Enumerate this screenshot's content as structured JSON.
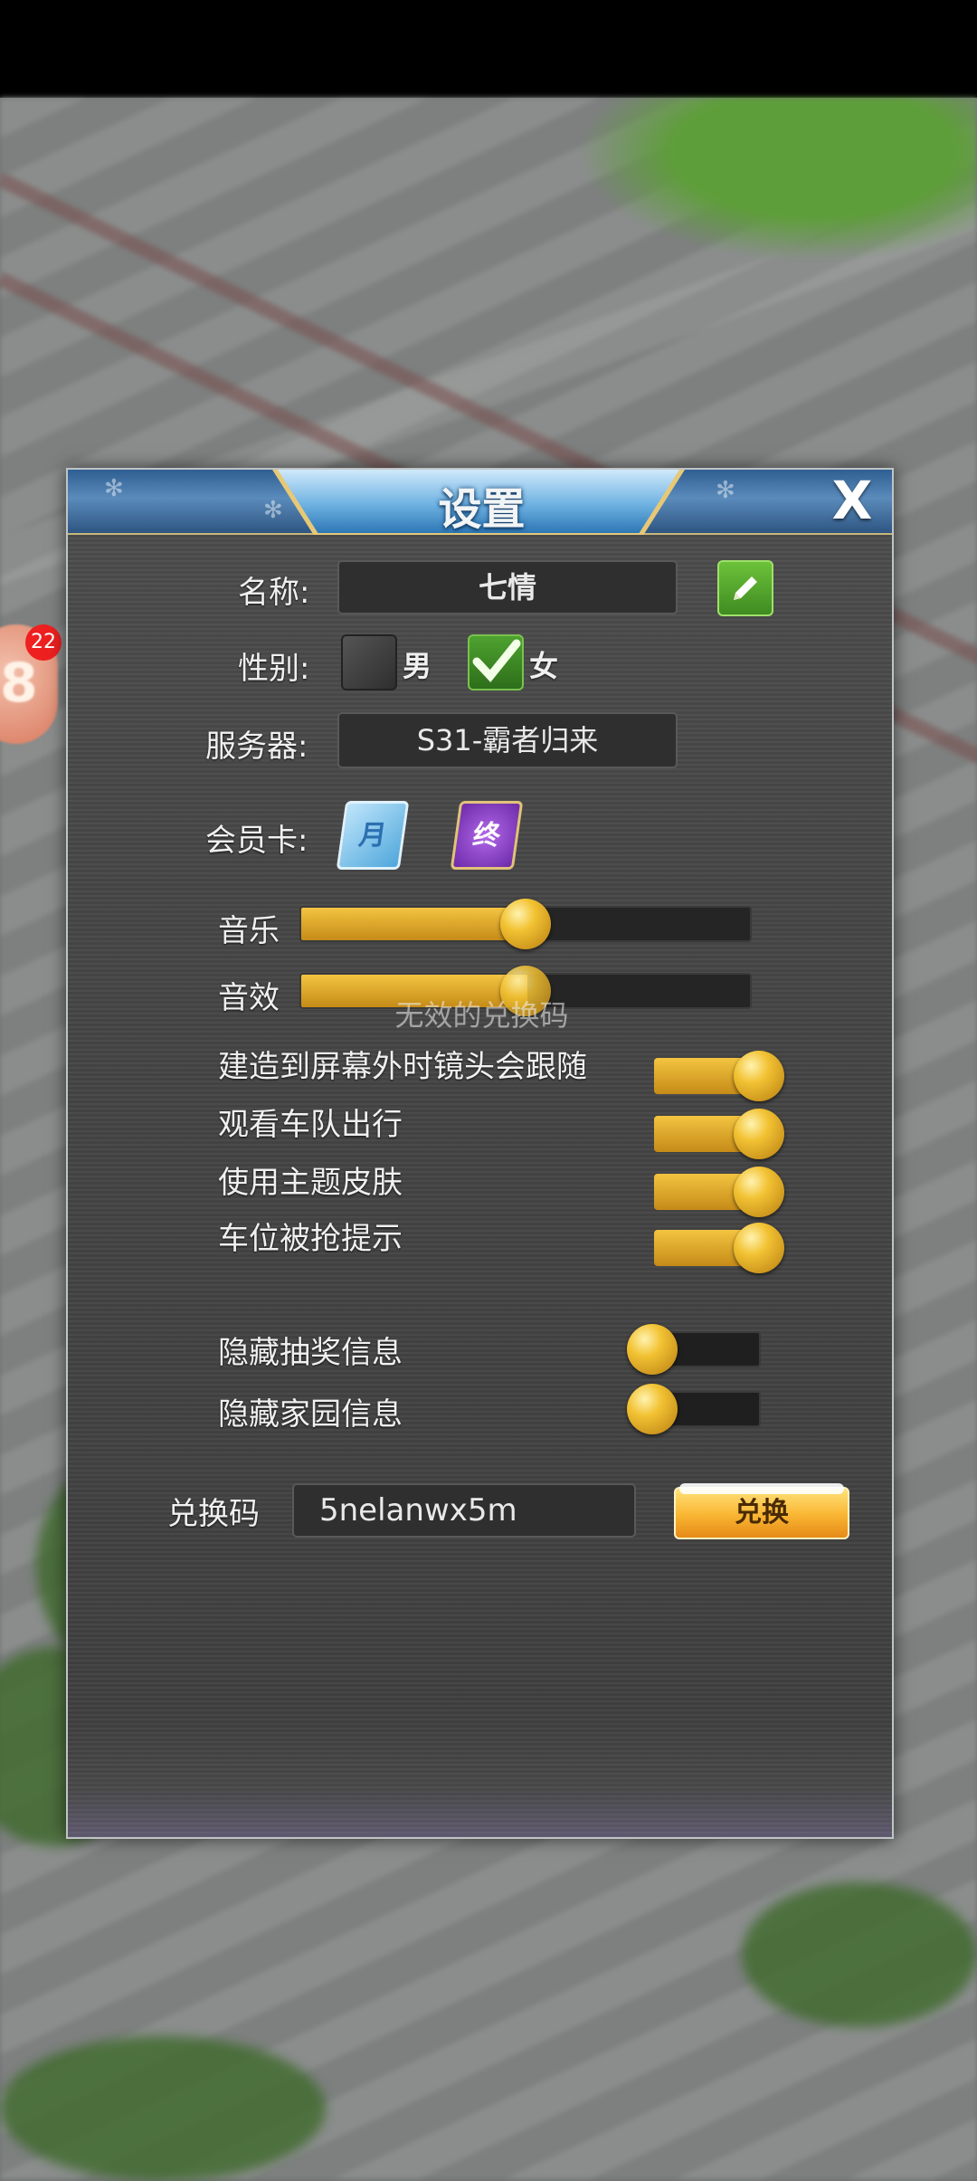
{
  "panel": {
    "title": "设置",
    "close_label": "X"
  },
  "side_badge": {
    "icon_text": "8",
    "count": "22"
  },
  "profile": {
    "name_label": "名称:",
    "name_value": "七情",
    "gender_label": "性别:",
    "gender_male": "男",
    "gender_female": "女",
    "gender_selected": "女",
    "server_label": "服务器:",
    "server_value": "S31-霸者归来",
    "vip_label": "会员卡:",
    "vip_cards": [
      "月",
      "终"
    ]
  },
  "audio": {
    "music_label": "音乐",
    "music_level": 0.5,
    "sfx_label": "音效",
    "sfx_level": 0.5
  },
  "toggles_on": [
    {
      "label": "建造到屏幕外时镜头会跟随",
      "on": true
    },
    {
      "label": "观看车队出行",
      "on": true
    },
    {
      "label": "使用主题皮肤",
      "on": true
    },
    {
      "label": "车位被抢提示",
      "on": true
    }
  ],
  "toggles_off": [
    {
      "label": "隐藏抽奖信息",
      "on": false
    },
    {
      "label": "隐藏家园信息",
      "on": false
    }
  ],
  "redeem": {
    "label": "兑换码",
    "value": "5nelanwx5m",
    "button": "兑换",
    "toast": "无效的兑换码"
  },
  "colors": {
    "accent_gold": "#f2c233",
    "header_blue": "#5a8bbb",
    "panel_bg": "#454545"
  }
}
